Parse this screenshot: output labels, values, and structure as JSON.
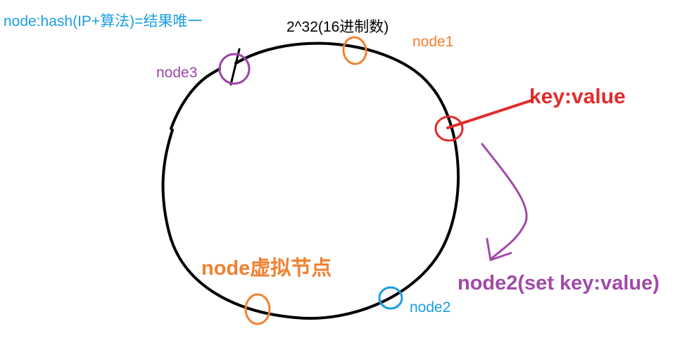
{
  "texts": {
    "formula": "node:hash(IP+算法)=结果唯一",
    "ring_size": "2^32(16进制数)",
    "node1": "node1",
    "node2": "node2",
    "node3": "node3",
    "key_value": "key:value",
    "virtual_node": "node虚拟节点",
    "node2_set": "node2(set key:value)"
  },
  "colors": {
    "formula": "#1a9ee3",
    "ring": "#000000",
    "node1": "#f28030",
    "node2": "#1a9ee3",
    "node3": "#9b45a6",
    "key": "#e22a2a",
    "arrow": "#a04aa8",
    "virtual_node": "#f28030",
    "node2_set": "#a04aa8"
  }
}
